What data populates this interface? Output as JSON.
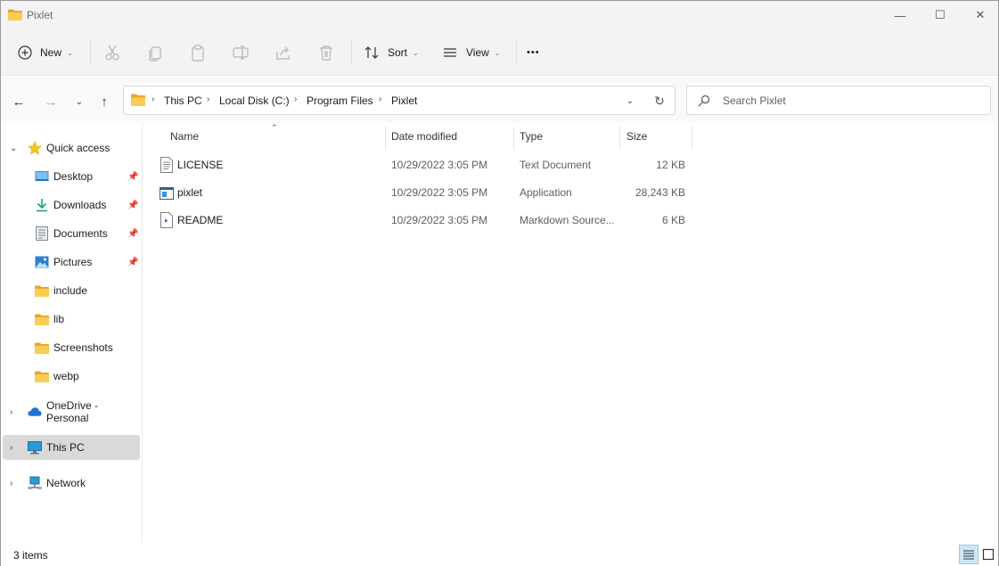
{
  "window": {
    "title": "Pixlet",
    "minimize_glyph": "—",
    "maximize_glyph": "☐",
    "close_glyph": "✕"
  },
  "toolbar": {
    "new_label": "New",
    "sort_label": "Sort",
    "view_label": "View",
    "more_glyph": "•••",
    "disabled_actions": [
      "cut-icon",
      "copy-icon",
      "paste-icon",
      "rename-icon",
      "share-icon",
      "delete-icon"
    ]
  },
  "address": {
    "breadcrumbs": [
      "This PC",
      "Local Disk (C:)",
      "Program Files",
      "Pixlet"
    ],
    "separator": "›"
  },
  "search": {
    "placeholder": "Search Pixlet"
  },
  "nav": {
    "quick_access": "Quick access",
    "items": [
      {
        "label": "Desktop",
        "icon": "desktop-icon",
        "pinned": true
      },
      {
        "label": "Downloads",
        "icon": "downloads-icon",
        "pinned": true
      },
      {
        "label": "Documents",
        "icon": "documents-icon",
        "pinned": true
      },
      {
        "label": "Pictures",
        "icon": "pictures-icon",
        "pinned": true
      },
      {
        "label": "include",
        "icon": "folder-icon",
        "pinned": false
      },
      {
        "label": "lib",
        "icon": "folder-icon",
        "pinned": false
      },
      {
        "label": "Screenshots",
        "icon": "folder-icon",
        "pinned": false
      },
      {
        "label": "webp",
        "icon": "folder-icon",
        "pinned": false
      }
    ],
    "onedrive": "OneDrive - Personal",
    "this_pc": "This PC",
    "network": "Network"
  },
  "columns": {
    "name": "Name",
    "date": "Date modified",
    "type": "Type",
    "size": "Size"
  },
  "files": [
    {
      "name": "LICENSE",
      "date": "10/29/2022 3:05 PM",
      "type": "Text Document",
      "size": "12 KB",
      "icon": "text-file-icon"
    },
    {
      "name": "pixlet",
      "date": "10/29/2022 3:05 PM",
      "type": "Application",
      "size": "28,243 KB",
      "icon": "application-icon"
    },
    {
      "name": "README",
      "date": "10/29/2022 3:05 PM",
      "type": "Markdown Source...",
      "size": "6 KB",
      "icon": "markdown-file-icon"
    }
  ],
  "status": {
    "item_count": "3 items"
  },
  "colors": {
    "accent": "#0078d4",
    "folder": "#f0c24a",
    "selected_nav": "#d9d9d9"
  }
}
